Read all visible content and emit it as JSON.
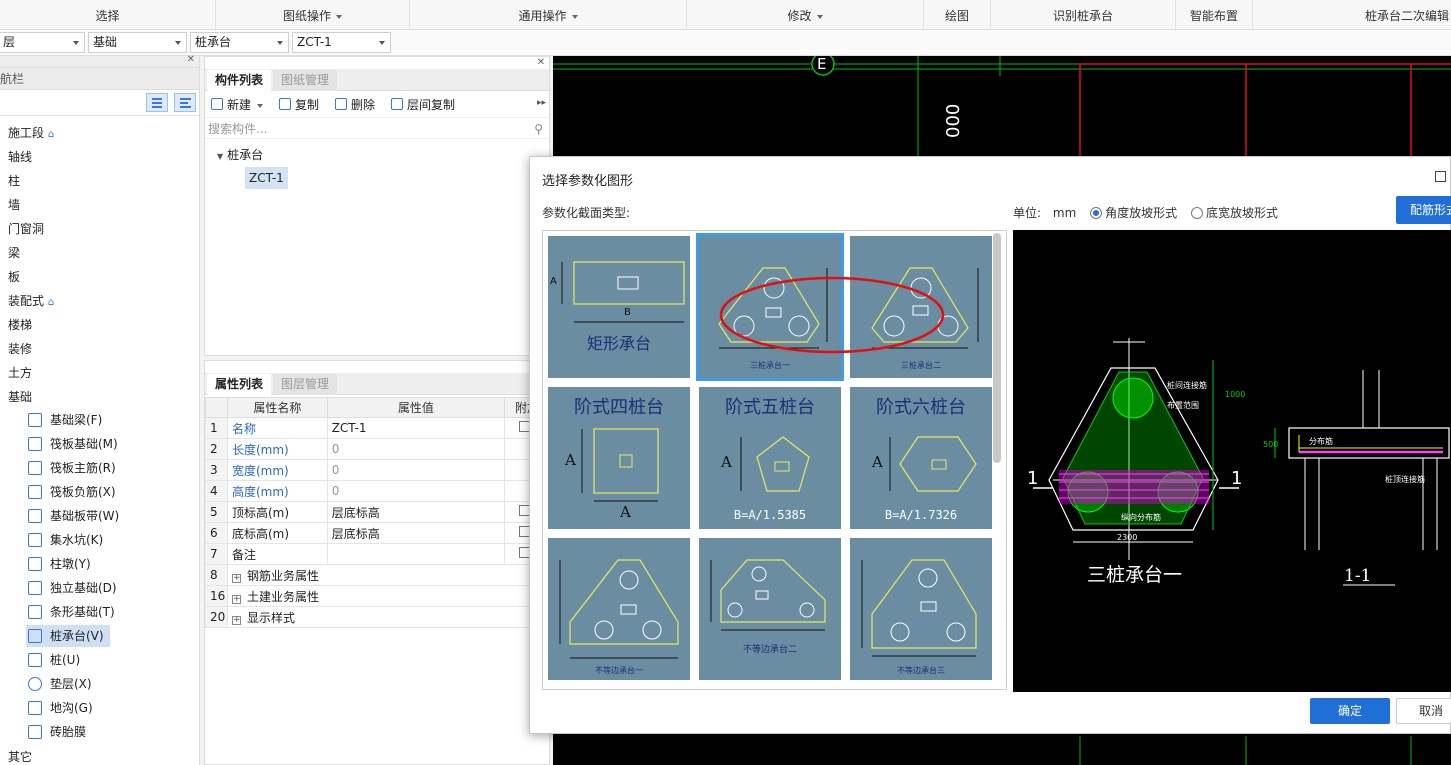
{
  "ribbon": {
    "groups": [
      "选择",
      "图纸操作",
      "通用操作",
      "修改",
      "绘图",
      "识别桩承台",
      "智能布置",
      "桩承台二次编辑"
    ]
  },
  "selectors": {
    "floor": "层",
    "category": "基础",
    "component_type": "桩承台",
    "component": "ZCT-1"
  },
  "nav": {
    "title": "导航栏",
    "items": [
      "施工段",
      "轴线",
      "柱",
      "墙",
      "门窗洞",
      "梁",
      "板",
      "装配式",
      "楼梯",
      "装修",
      "土方",
      "基础"
    ],
    "sub_items": [
      "基础梁(F)",
      "筏板基础(M)",
      "筏板主筋(R)",
      "筏板负筋(X)",
      "基础板带(W)",
      "集水坑(K)",
      "柱墩(Y)",
      "独立基础(D)",
      "条形基础(T)",
      "桩承台(V)",
      "桩(U)",
      "垫层(X)",
      "地沟(G)",
      "砖胎膜"
    ],
    "selected_sub": "桩承台(V)",
    "last_item": "其它"
  },
  "component_list": {
    "tab_active": "构件列表",
    "tab_inactive": "图纸管理",
    "tools": {
      "new": "新建",
      "copy": "复制",
      "delete": "删除",
      "floor_copy": "层间复制"
    },
    "search_placeholder": "搜索构件...",
    "tree_root": "桩承台",
    "tree_child": "ZCT-1"
  },
  "properties": {
    "tab_active": "属性列表",
    "tab_inactive": "图层管理",
    "headers": [
      "属性名称",
      "属性值",
      "附加"
    ],
    "rows": [
      {
        "num": "1",
        "name": "名称",
        "value": "ZCT-1"
      },
      {
        "num": "2",
        "name": "长度(mm)",
        "value": "0"
      },
      {
        "num": "3",
        "name": "宽度(mm)",
        "value": "0"
      },
      {
        "num": "4",
        "name": "高度(mm)",
        "value": "0"
      },
      {
        "num": "5",
        "name": "顶标高(m)",
        "value": "层底标高"
      },
      {
        "num": "6",
        "name": "底标高(m)",
        "value": "层底标高"
      },
      {
        "num": "7",
        "name": "备注",
        "value": ""
      },
      {
        "num": "8",
        "name": "钢筋业务属性",
        "value": ""
      },
      {
        "num": "16",
        "name": "土建业务属性",
        "value": ""
      },
      {
        "num": "20",
        "name": "显示样式",
        "value": ""
      }
    ]
  },
  "cad": {
    "axis_label": "E",
    "dim_text": "000"
  },
  "dialog": {
    "title": "选择参数化图形",
    "type_label": "参数化截面类型:",
    "unit_label": "单位:",
    "unit_value": "mm",
    "radio_angle": "角度放坡形式",
    "radio_width": "底宽放坡形式",
    "rebar_button": "配筋形式",
    "ok": "确定",
    "cancel": "取消",
    "thumbnails": [
      {
        "label": "矩形承台",
        "dim_a": "A",
        "dim_b": "B"
      },
      {
        "label": "三桩承台一"
      },
      {
        "label": "三桩承台二"
      },
      {
        "label": "阶式四桩台",
        "dim_a": "A",
        "dim_b": "A"
      },
      {
        "label": "阶式五桩台",
        "dim_a": "A",
        "formula": "B=A/1.5385"
      },
      {
        "label": "阶式六桩台",
        "dim_a": "A",
        "formula": "B=A/1.7326"
      },
      {
        "label": "不等边承台一"
      },
      {
        "label": "不等边承台二"
      },
      {
        "label": "不等边承台三"
      }
    ],
    "preview": {
      "title": "三桩承台一",
      "section": "1-1",
      "marker": "1",
      "notes": [
        "桩间连接筋",
        "布置范围",
        "纵向分布筋",
        "分布筋",
        "桩顶连接筋"
      ],
      "dims": [
        "2300",
        "1000",
        "500"
      ]
    }
  },
  "colors": {
    "accent": "#1f6fd6",
    "thumb_bg": "#6b8da2",
    "annotation_red": "#e01010",
    "cad_green": "#00d000"
  }
}
